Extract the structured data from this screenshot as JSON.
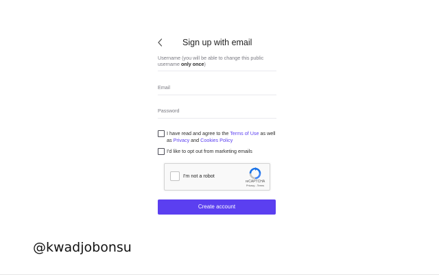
{
  "form": {
    "title": "Sign up with email",
    "username": {
      "label_start": "Username (you will be able to change this public username ",
      "label_bold": "only once",
      "label_end": ")"
    },
    "email": {
      "label": "Email"
    },
    "password": {
      "label": "Password"
    },
    "terms": {
      "text_1": "I have read and agree to the ",
      "terms_link": "Terms of Use",
      "text_2": " as well as ",
      "privacy_link": "Privacy",
      "text_3": " and ",
      "cookies_link": "Cookies Policy"
    },
    "optout": {
      "label": "I'd like to opt out from marketing emails"
    },
    "captcha": {
      "label": "I'm not a robot",
      "brand": "reCAPTCHA",
      "privacy": "Privacy",
      "separator": " - ",
      "terms": "Terms"
    },
    "submit_label": "Create account"
  },
  "watermark": "@kwadjobonsu",
  "colors": {
    "accent": "#5b3ff0",
    "background": "#ffffff"
  },
  "icons": {
    "back": "chevron-left-icon",
    "captcha": "recaptcha-logo-icon"
  }
}
